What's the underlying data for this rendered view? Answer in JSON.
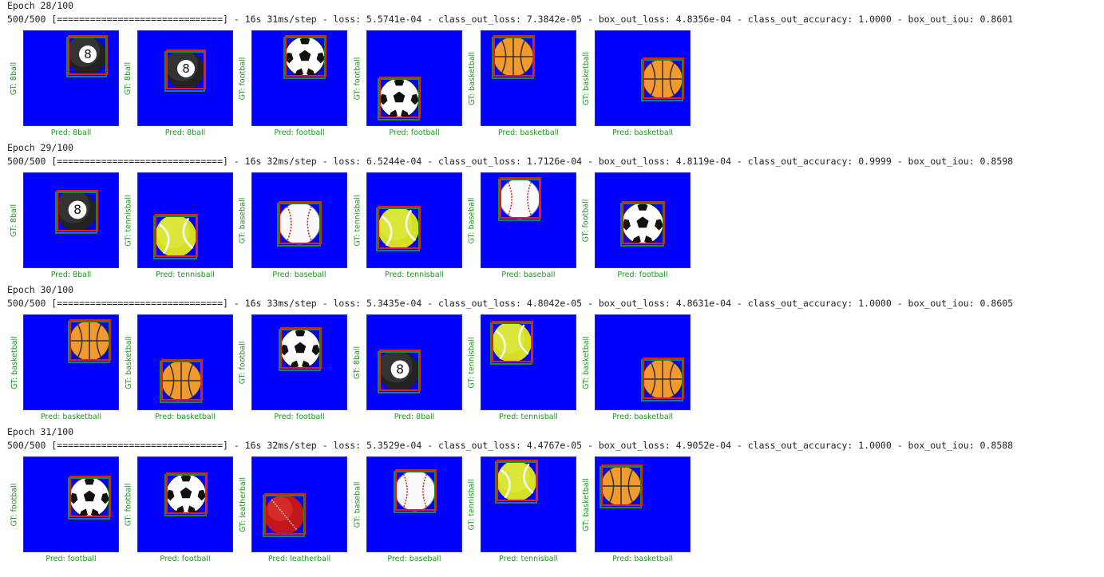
{
  "colors": {
    "background": "#ffffff",
    "text": "#222222",
    "label_green": "#1b9a1b",
    "image_blue": "#0000fe",
    "gt_box": "#1f8a2a",
    "pred_box": "#e01c1c"
  },
  "epochs": [
    {
      "epoch_text": "Epoch 28/100",
      "progress_text": "500/500 [==============================] - 16s 31ms/step - loss: 5.5741e-04 - class_out_loss: 7.3842e-05 - box_out_loss: 4.8356e-04 - class_out_accuracy: 1.0000 - box_out_iou: 0.8601",
      "samples": [
        {
          "gt": "GT: 8ball",
          "pred": "Pred: 8ball",
          "ball": "8ball"
        },
        {
          "gt": "GT: 8ball",
          "pred": "Pred: 8ball",
          "ball": "8ball"
        },
        {
          "gt": "GT: football",
          "pred": "Pred: football",
          "ball": "football"
        },
        {
          "gt": "GT: football",
          "pred": "Pred: football",
          "ball": "football"
        },
        {
          "gt": "GT: basketball",
          "pred": "Pred: basketball",
          "ball": "basketball"
        },
        {
          "gt": "GT: basketball",
          "pred": "Pred: basketball",
          "ball": "basketball"
        }
      ]
    },
    {
      "epoch_text": "Epoch 29/100",
      "progress_text": "500/500 [==============================] - 16s 32ms/step - loss: 6.5244e-04 - class_out_loss: 1.7126e-04 - box_out_loss: 4.8119e-04 - class_out_accuracy: 0.9999 - box_out_iou: 0.8598",
      "samples": [
        {
          "gt": "GT: 8ball",
          "pred": "Pred: 8ball",
          "ball": "8ball"
        },
        {
          "gt": "GT: tennisball",
          "pred": "Pred: tennisball",
          "ball": "tennisball"
        },
        {
          "gt": "GT: baseball",
          "pred": "Pred: baseball",
          "ball": "baseball"
        },
        {
          "gt": "GT: tennisball",
          "pred": "Pred: tennisball",
          "ball": "tennisball"
        },
        {
          "gt": "GT: baseball",
          "pred": "Pred: baseball",
          "ball": "baseball"
        },
        {
          "gt": "GT: football",
          "pred": "Pred: football",
          "ball": "football"
        }
      ]
    },
    {
      "epoch_text": "Epoch 30/100",
      "progress_text": "500/500 [==============================] - 16s 33ms/step - loss: 5.3435e-04 - class_out_loss: 4.8042e-05 - box_out_loss: 4.8631e-04 - class_out_accuracy: 1.0000 - box_out_iou: 0.8605",
      "samples": [
        {
          "gt": "GT: basketball",
          "pred": "Pred: basketball",
          "ball": "basketball"
        },
        {
          "gt": "GT: basketball",
          "pred": "Pred: basketball",
          "ball": "basketball"
        },
        {
          "gt": "GT: football",
          "pred": "Pred: football",
          "ball": "football"
        },
        {
          "gt": "GT: 8ball",
          "pred": "Pred: 8ball",
          "ball": "8ball"
        },
        {
          "gt": "GT: tennisball",
          "pred": "Pred: tennisball",
          "ball": "tennisball"
        },
        {
          "gt": "GT: basketball",
          "pred": "Pred: basketball",
          "ball": "basketball"
        }
      ]
    },
    {
      "epoch_text": "Epoch 31/100",
      "progress_text": "500/500 [==============================] - 16s 32ms/step - loss: 5.3529e-04 - class_out_loss: 4.4767e-05 - box_out_loss: 4.9052e-04 - class_out_accuracy: 1.0000 - box_out_iou: 0.8588",
      "samples": [
        {
          "gt": "GT: football",
          "pred": "Pred: football",
          "ball": "football"
        },
        {
          "gt": "GT: football",
          "pred": "Pred: football",
          "ball": "football"
        },
        {
          "gt": "GT: leatherball",
          "pred": "Pred: leatherball",
          "ball": "leatherball"
        },
        {
          "gt": "GT: baseball",
          "pred": "Pred: baseball",
          "ball": "baseball"
        },
        {
          "gt": "GT: tennisball",
          "pred": "Pred: tennisball",
          "ball": "tennisball"
        },
        {
          "gt": "GT: basketball",
          "pred": "Pred: basketball",
          "ball": "basketball"
        }
      ]
    }
  ]
}
